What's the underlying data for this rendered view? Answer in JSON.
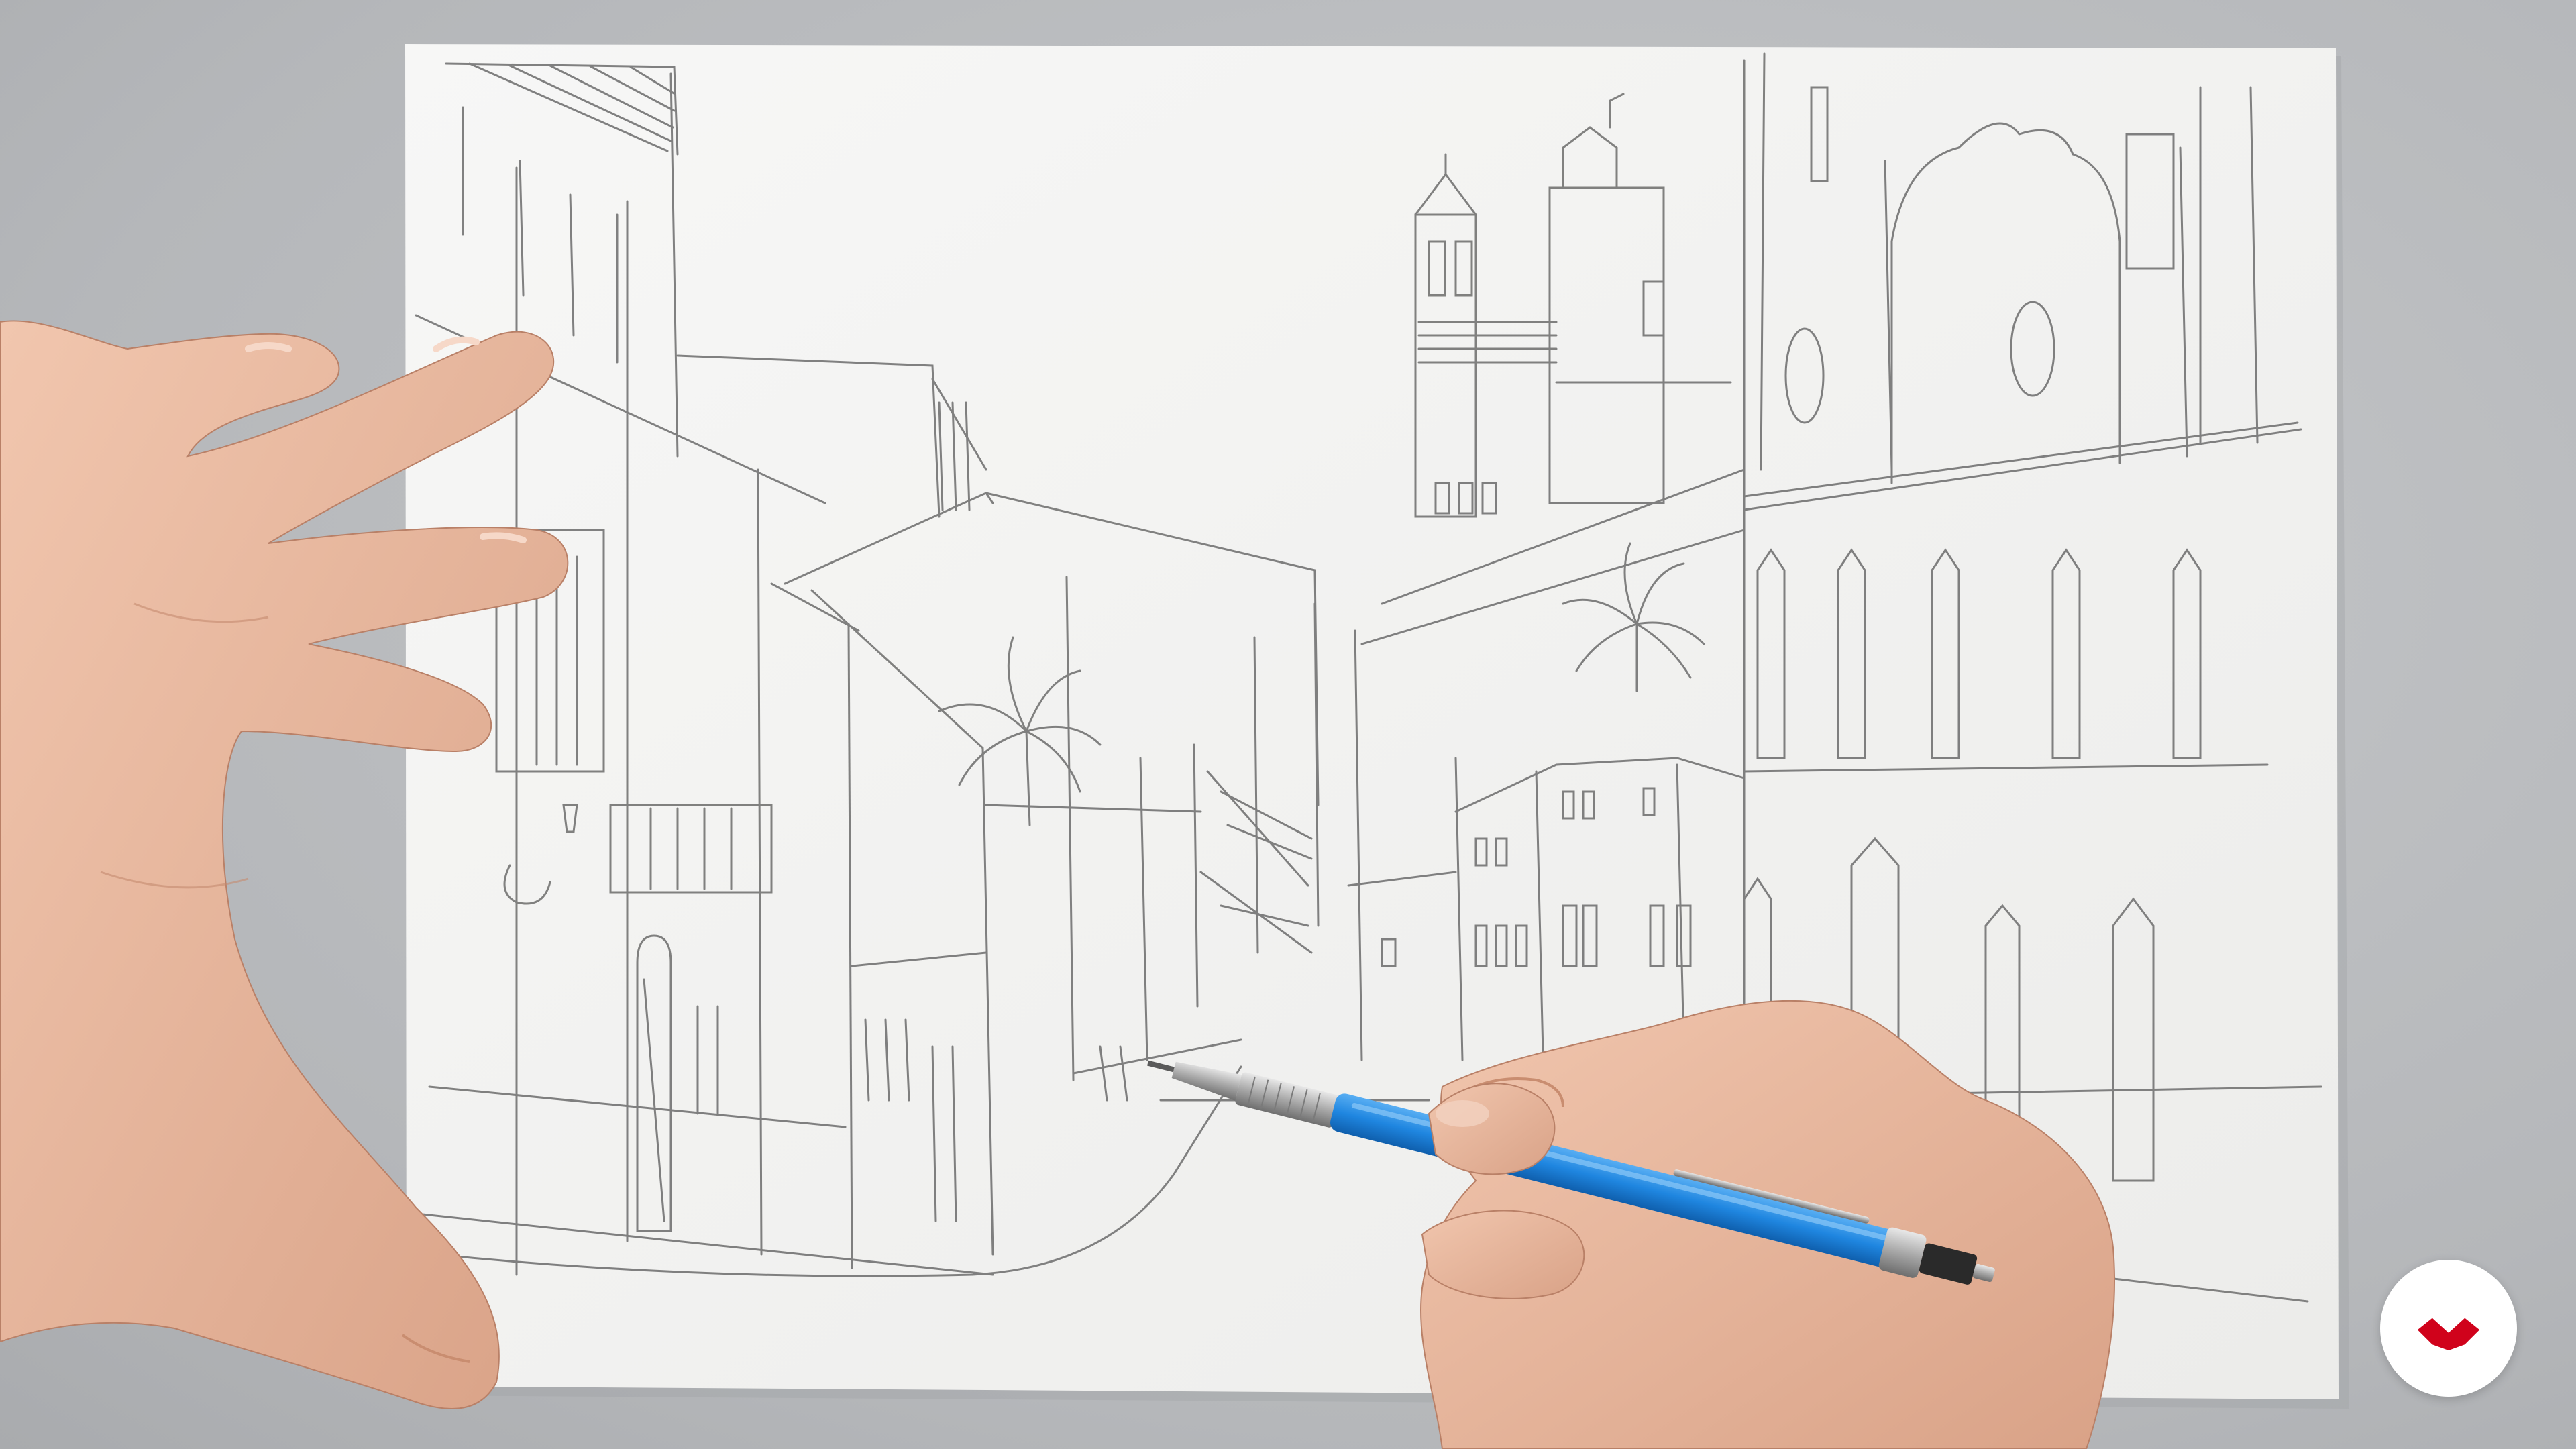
{
  "scene": {
    "subject": "pencil-sketch-of-street-with-towers",
    "background_color": "#b9bbbe",
    "paper_color": "#f3f3f2",
    "pencil_barrel_color": "#1f86e0",
    "skin_color": "#e9b9a0"
  },
  "brand": {
    "icon": "brand-logo-icon",
    "badge_color": "#ffffff",
    "logo_color": "#d0021b"
  }
}
